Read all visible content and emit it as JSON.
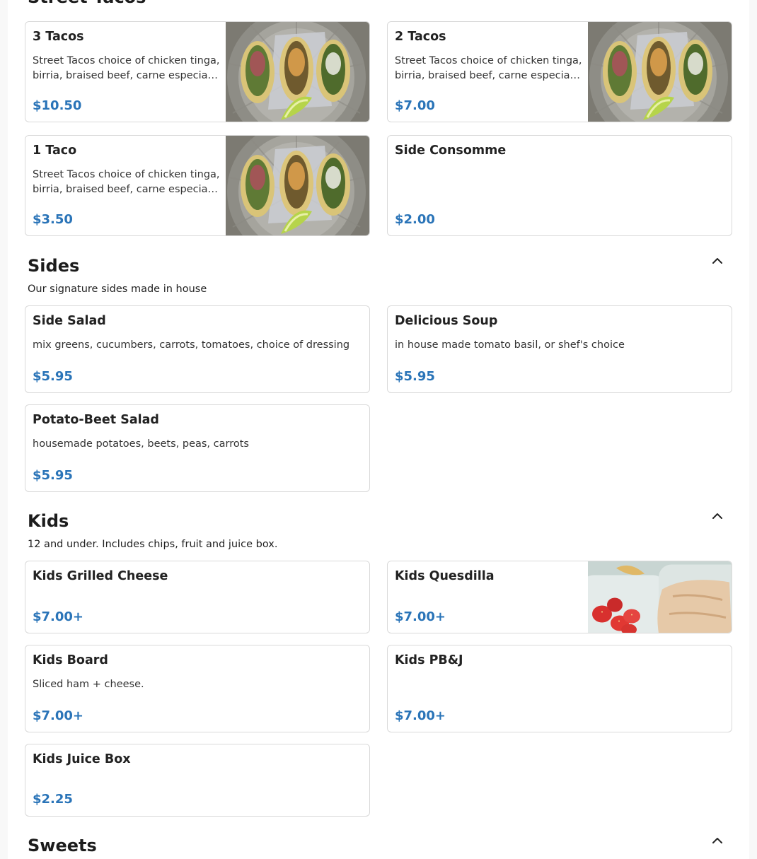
{
  "street_tacos": {
    "title": "Street Tacos",
    "items": [
      {
        "name": "3 Tacos",
        "desc": "Street Tacos choice of chicken tinga, birria, braised beef, carne especial, al pastor",
        "price": "$10.50",
        "image": "tacos-photo"
      },
      {
        "name": "2 Tacos",
        "desc": "Street Tacos choice of chicken tinga, birria, braised beef, carne especial, al pastor",
        "price": "$7.00",
        "image": "tacos-photo"
      },
      {
        "name": "1 Taco",
        "desc": "Street Tacos choice of chicken tinga, birria, braised beef, carne especial, al pastor",
        "price": "$3.50",
        "image": "tacos-photo"
      },
      {
        "name": "Side Consomme",
        "desc": "",
        "price": "$2.00"
      }
    ]
  },
  "sides": {
    "title": "Sides",
    "description": "Our signature sides made in house",
    "toggle_icon": "chevron-up-icon",
    "items": [
      {
        "name": "Side Salad",
        "desc": "mix greens, cucumbers, carrots, tomatoes, choice of dressing",
        "price": "$5.95"
      },
      {
        "name": "Delicious Soup",
        "desc": "in house made tomato basil, or shef's choice",
        "price": "$5.95"
      },
      {
        "name": "Potato-Beet Salad",
        "desc": "housemade potatoes, beets, peas, carrots",
        "price": "$5.95"
      }
    ]
  },
  "kids": {
    "title": "Kids",
    "description": "12 and under. Includes chips, fruit and juice box.",
    "toggle_icon": "chevron-up-icon",
    "items": [
      {
        "name": "Kids Grilled Cheese",
        "desc": "",
        "price": "$7.00+"
      },
      {
        "name": "Kids Quesdilla",
        "desc": "",
        "price": "$7.00+",
        "image": "quesadilla-photo"
      },
      {
        "name": "Kids Board",
        "desc": "Sliced ham + cheese.",
        "price": "$7.00+"
      },
      {
        "name": "Kids PB&J",
        "desc": "",
        "price": "$7.00+"
      },
      {
        "name": "Kids Juice Box",
        "desc": "",
        "price": "$2.25"
      }
    ]
  },
  "sweets": {
    "title": "Sweets",
    "toggle_icon": "chevron-up-icon"
  },
  "colors": {
    "price": "#2a74b8",
    "border": "#d9d9d9"
  }
}
